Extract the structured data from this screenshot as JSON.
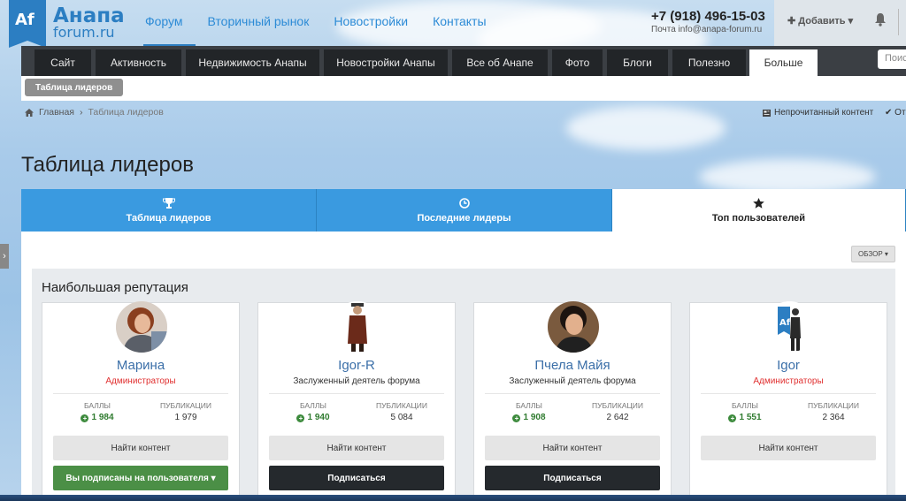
{
  "logo": {
    "mark": "Af",
    "line1": "Анапа",
    "line2": "forum.ru"
  },
  "mainnav": [
    {
      "label": "Форум",
      "active": true
    },
    {
      "label": "Вторичный рынок"
    },
    {
      "label": "Новостройки"
    },
    {
      "label": "Контакты"
    }
  ],
  "contact": {
    "phone": "+7 (918) 496-15-03",
    "mail": "Почта info@anapa-forum.ru"
  },
  "userbar": {
    "add_label": "✚ Добавить ▾"
  },
  "tabs": [
    "Сайт",
    "Активность",
    "Недвижимость Анапы",
    "Новостройки Анапы",
    "Все об Анапе",
    "Фото",
    "Блоги",
    "Полезно",
    "Больше"
  ],
  "search_placeholder": "Поис",
  "subnav": {
    "active": "Таблица лидеров"
  },
  "breadcrumb": {
    "home": "Главная",
    "current": "Таблица лидеров"
  },
  "actions": {
    "unread": "Непрочитанный контент",
    "other": "От"
  },
  "page_title": "Таблица лидеров",
  "lb_tabs": [
    {
      "label": "Таблица лидеров",
      "icon": "trophy-icon"
    },
    {
      "label": "Последние лидеры",
      "icon": "clock-icon"
    },
    {
      "label": "Топ пользователей",
      "icon": "star-icon",
      "active": true
    }
  ],
  "overview_label": "ОБЗОР ▾",
  "section_title": "Наибольшая репутация",
  "labels": {
    "points": "БАЛЛЫ",
    "posts": "ПУБЛИКАЦИИ",
    "find": "Найти контент",
    "subscribed": "Вы подписаны на пользователя ▾",
    "subscribe": "Подписаться"
  },
  "users": [
    {
      "name": "Марина",
      "group": "Администраторы",
      "admin": true,
      "points": "1 984",
      "posts": "1 979",
      "follow": "subscribed"
    },
    {
      "name": "Igor-R",
      "group": "Заслуженный деятель форума",
      "admin": false,
      "points": "1 940",
      "posts": "5 084",
      "follow": "subscribe"
    },
    {
      "name": "Пчела Майя",
      "group": "Заслуженный деятель форума",
      "admin": false,
      "points": "1 908",
      "posts": "2 642",
      "follow": "subscribe"
    },
    {
      "name": "Igor",
      "group": "Администраторы",
      "admin": true,
      "points": "1 551",
      "posts": "2 364",
      "follow": "none"
    }
  ],
  "colors": {
    "accent": "#3a9ae0",
    "brand": "#2c7ec2",
    "admin": "#e03030",
    "positive": "#2f7b2f"
  }
}
